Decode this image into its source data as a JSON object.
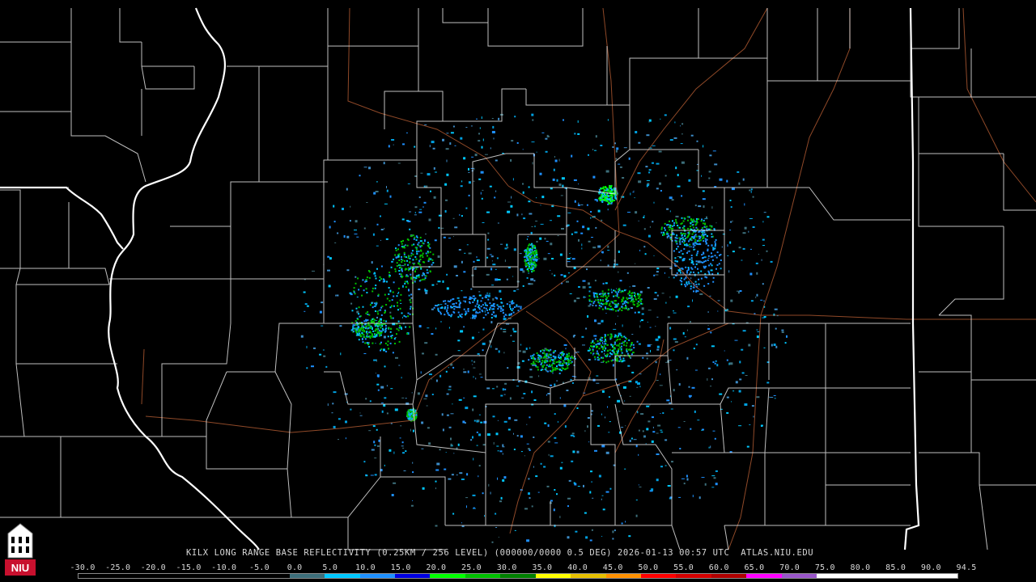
{
  "map": {
    "caption": {
      "station": "KILX",
      "product": "LONG RANGE BASE REFLECTIVITY",
      "resolution": "(0.25KM / 256 LEVEL)",
      "volume": "(000000/0000 0.5 DEG)",
      "timestamp": "2026-01-13 00:57 UTC",
      "source": "ATLAS.NIU.EDU",
      "full": "KILX LONG RANGE BASE REFLECTIVITY (0.25KM / 256 LEVEL) (000000/0000 0.5 DEG) 2026-01-13 00:57 UTC  ATLAS.NIU.EDU"
    },
    "colorbar": {
      "ticks": [
        "-30.0",
        "-25.0",
        "-20.0",
        "-15.0",
        "-10.0",
        "-5.0",
        "0.0",
        "5.0",
        "10.0",
        "15.0",
        "20.0",
        "25.0",
        "30.0",
        "35.0",
        "40.0",
        "45.0",
        "50.0",
        "55.0",
        "60.0",
        "65.0",
        "70.0",
        "75.0",
        "80.0",
        "85.0",
        "90.0",
        "94.5"
      ],
      "colors": [
        "#000000",
        "#000000",
        "#000000",
        "#000000",
        "#000000",
        "#000000",
        "#3c6e7a",
        "#00c8ff",
        "#1e90ff",
        "#0000e0",
        "#00ff00",
        "#00c000",
        "#008000",
        "#ffff00",
        "#e6c000",
        "#ff9000",
        "#ff0000",
        "#d40000",
        "#b00000",
        "#ff00ff",
        "#9955c9",
        "#ffffff",
        "#ffffff",
        "#ffffff",
        "#ffffff"
      ]
    },
    "logo": {
      "text": "NIU",
      "icon": "niu-tower-logo"
    },
    "colors": {
      "background": "#000000",
      "county_lines": "#ffffff",
      "state_lines": "#ffffff",
      "highways": "#a0522d"
    }
  }
}
